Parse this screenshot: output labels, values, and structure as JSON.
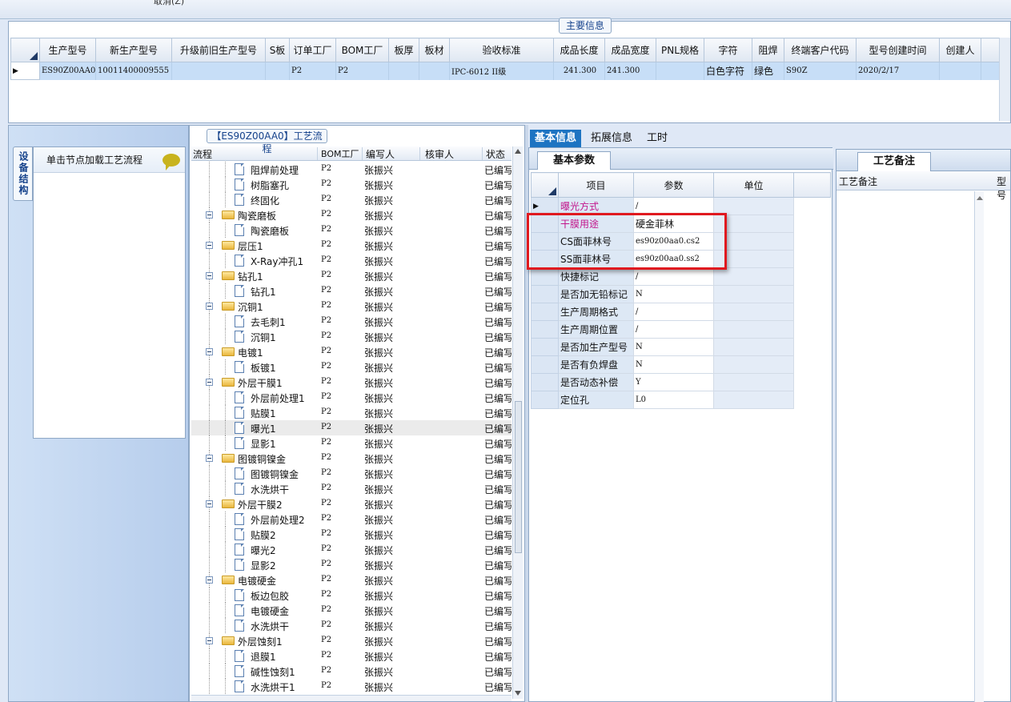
{
  "top": {
    "cut_text": "取消(Z)"
  },
  "main_info": {
    "title": "主要信息",
    "columns": [
      "生产型号",
      "新生产型号",
      "升级前旧生产型号",
      "S板",
      "订单工厂",
      "BOM工厂",
      "板厚",
      "板材",
      "验收标准",
      "成品长度",
      "成品宽度",
      "PNL规格",
      "字符",
      "阻焊",
      "终端客户代码",
      "型号创建时间",
      "创建人"
    ],
    "row": [
      "ES90Z00AA0",
      "10011400009555",
      "",
      "",
      "P2",
      "P2",
      "",
      "",
      "IPC-6012 II级",
      "241.300",
      "241.300",
      "",
      "白色字符",
      "绿色",
      "S90Z",
      "2020/2/17",
      ""
    ]
  },
  "left_panel": {
    "side_tab": "设备结构",
    "load_label": "单击节点加载工艺流程"
  },
  "process": {
    "caption": "【ES90Z00AA0】工艺流程",
    "columns": [
      "流程",
      "BOM工厂",
      "编写人",
      "核审人",
      "状态"
    ],
    "rows": [
      {
        "name": "阻焊前处理",
        "lvl": 2,
        "bom": "P2",
        "writer": "张振兴",
        "status": "已编写"
      },
      {
        "name": "树脂塞孔",
        "lvl": 2,
        "bom": "P2",
        "writer": "张振兴",
        "status": "已编写"
      },
      {
        "name": "终固化",
        "lvl": 2,
        "bom": "P2",
        "writer": "张振兴",
        "status": "已编写"
      },
      {
        "name": "陶瓷磨板",
        "lvl": 1,
        "bom": "P2",
        "writer": "张振兴",
        "status": "已编写"
      },
      {
        "name": "陶瓷磨板",
        "lvl": 2,
        "bom": "P2",
        "writer": "张振兴",
        "status": "已编写"
      },
      {
        "name": "层压1",
        "lvl": 1,
        "bom": "P2",
        "writer": "张振兴",
        "status": "已编写"
      },
      {
        "name": "X-Ray冲孔1",
        "lvl": 2,
        "bom": "P2",
        "writer": "张振兴",
        "status": "已编写"
      },
      {
        "name": "钻孔1",
        "lvl": 1,
        "bom": "P2",
        "writer": "张振兴",
        "status": "已编写"
      },
      {
        "name": "钻孔1",
        "lvl": 2,
        "bom": "P2",
        "writer": "张振兴",
        "status": "已编写"
      },
      {
        "name": "沉铜1",
        "lvl": 1,
        "bom": "P2",
        "writer": "张振兴",
        "status": "已编写"
      },
      {
        "name": "去毛刺1",
        "lvl": 2,
        "bom": "P2",
        "writer": "张振兴",
        "status": "已编写"
      },
      {
        "name": "沉铜1",
        "lvl": 2,
        "bom": "P2",
        "writer": "张振兴",
        "status": "已编写"
      },
      {
        "name": "电镀1",
        "lvl": 1,
        "bom": "P2",
        "writer": "张振兴",
        "status": "已编写"
      },
      {
        "name": "板镀1",
        "lvl": 2,
        "bom": "P2",
        "writer": "张振兴",
        "status": "已编写"
      },
      {
        "name": "外层干膜1",
        "lvl": 1,
        "bom": "P2",
        "writer": "张振兴",
        "status": "已编写"
      },
      {
        "name": "外层前处理1",
        "lvl": 2,
        "bom": "P2",
        "writer": "张振兴",
        "status": "已编写"
      },
      {
        "name": "贴膜1",
        "lvl": 2,
        "bom": "P2",
        "writer": "张振兴",
        "status": "已编写"
      },
      {
        "name": "曝光1",
        "lvl": 2,
        "bom": "P2",
        "writer": "张振兴",
        "status": "已编写",
        "selected": true
      },
      {
        "name": "显影1",
        "lvl": 2,
        "bom": "P2",
        "writer": "张振兴",
        "status": "已编写"
      },
      {
        "name": "图镀铜镍金",
        "lvl": 1,
        "bom": "P2",
        "writer": "张振兴",
        "status": "已编写"
      },
      {
        "name": "图镀铜镍金",
        "lvl": 2,
        "bom": "P2",
        "writer": "张振兴",
        "status": "已编写"
      },
      {
        "name": "水洗烘干",
        "lvl": 2,
        "bom": "P2",
        "writer": "张振兴",
        "status": "已编写"
      },
      {
        "name": "外层干膜2",
        "lvl": 1,
        "bom": "P2",
        "writer": "张振兴",
        "status": "已编写"
      },
      {
        "name": "外层前处理2",
        "lvl": 2,
        "bom": "P2",
        "writer": "张振兴",
        "status": "已编写"
      },
      {
        "name": "贴膜2",
        "lvl": 2,
        "bom": "P2",
        "writer": "张振兴",
        "status": "已编写"
      },
      {
        "name": "曝光2",
        "lvl": 2,
        "bom": "P2",
        "writer": "张振兴",
        "status": "已编写"
      },
      {
        "name": "显影2",
        "lvl": 2,
        "bom": "P2",
        "writer": "张振兴",
        "status": "已编写"
      },
      {
        "name": "电镀硬金",
        "lvl": 1,
        "bom": "P2",
        "writer": "张振兴",
        "status": "已编写"
      },
      {
        "name": "板边包胶",
        "lvl": 2,
        "bom": "P2",
        "writer": "张振兴",
        "status": "已编写"
      },
      {
        "name": "电镀硬金",
        "lvl": 2,
        "bom": "P2",
        "writer": "张振兴",
        "status": "已编写"
      },
      {
        "name": "水洗烘干",
        "lvl": 2,
        "bom": "P2",
        "writer": "张振兴",
        "status": "已编写"
      },
      {
        "name": "外层蚀刻1",
        "lvl": 1,
        "bom": "P2",
        "writer": "张振兴",
        "status": "已编写"
      },
      {
        "name": "退膜1",
        "lvl": 2,
        "bom": "P2",
        "writer": "张振兴",
        "status": "已编写"
      },
      {
        "name": "碱性蚀刻1",
        "lvl": 2,
        "bom": "P2",
        "writer": "张振兴",
        "status": "已编写"
      },
      {
        "name": "水洗烘干1",
        "lvl": 2,
        "bom": "P2",
        "writer": "张振兴",
        "status": "已编写"
      }
    ]
  },
  "right_tabs": [
    "基本信息",
    "拓展信息",
    "工时"
  ],
  "basic": {
    "caption": "基本参数",
    "columns": [
      "项目",
      "参数",
      "单位"
    ],
    "rows": [
      {
        "item": "曝光方式",
        "value": "/",
        "unit": "",
        "pink": true,
        "current": true
      },
      {
        "item": "干膜用途",
        "value": "硬金菲林",
        "unit": "",
        "pink": true
      },
      {
        "item": "CS面菲林号",
        "value": "es90z00aa0.cs2",
        "unit": ""
      },
      {
        "item": "SS面菲林号",
        "value": "es90z00aa0.ss2",
        "unit": ""
      },
      {
        "item": "快捷标记",
        "value": "/",
        "unit": ""
      },
      {
        "item": "是否加无铅标记",
        "value": "N",
        "unit": ""
      },
      {
        "item": "生产周期格式",
        "value": "/",
        "unit": ""
      },
      {
        "item": "生产周期位置",
        "value": "/",
        "unit": ""
      },
      {
        "item": "是否加生产型号",
        "value": "N",
        "unit": ""
      },
      {
        "item": "是否有负焊盘",
        "value": "N",
        "unit": ""
      },
      {
        "item": "是否动态补偿",
        "value": "Y",
        "unit": ""
      },
      {
        "item": "定位孔",
        "value": "L0",
        "unit": ""
      }
    ]
  },
  "remarks": {
    "caption": "工艺备注",
    "col1": "工艺备注",
    "col2": "型号"
  }
}
